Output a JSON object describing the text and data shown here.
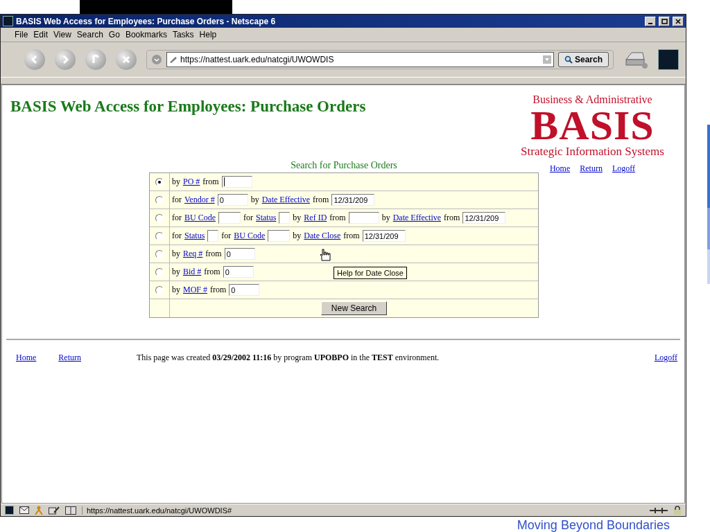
{
  "window": {
    "title": "BASIS Web Access for Employees: Purchase Orders - Netscape 6"
  },
  "menu": [
    "File",
    "Edit",
    "View",
    "Search",
    "Go",
    "Bookmarks",
    "Tasks",
    "Help"
  ],
  "toolbar": {
    "url": "https://nattest.uark.edu/natcgi/UWOWDIS",
    "search_label": "Search"
  },
  "page": {
    "heading": "BASIS Web Access for Employees: Purchase Orders",
    "logo": {
      "top": "Business & Administrative",
      "word": "BASIS",
      "bottom": "Strategic Information Systems"
    },
    "nav_links": [
      "Home",
      "Return",
      "Logoff"
    ],
    "form": {
      "title": "Search for Purchase Orders",
      "rows": [
        {
          "selected": true,
          "parts": [
            {
              "kind": "text",
              "text": "by"
            },
            {
              "kind": "link",
              "text": "PO #"
            },
            {
              "kind": "text",
              "text": "from"
            },
            {
              "kind": "field",
              "focused": true
            }
          ]
        },
        {
          "selected": false,
          "parts": [
            {
              "kind": "text",
              "text": "for"
            },
            {
              "kind": "link",
              "text": "Vendor #"
            },
            {
              "kind": "field",
              "value": "0"
            },
            {
              "kind": "text",
              "text": "by"
            },
            {
              "kind": "link",
              "text": "Date Effective"
            },
            {
              "kind": "text",
              "text": "from"
            },
            {
              "kind": "date",
              "value": "12/31/209"
            }
          ]
        },
        {
          "selected": false,
          "parts": [
            {
              "kind": "text",
              "text": "for"
            },
            {
              "kind": "link",
              "text": "BU Code"
            },
            {
              "kind": "small"
            },
            {
              "kind": "text",
              "text": "for"
            },
            {
              "kind": "link",
              "text": "Status"
            },
            {
              "kind": "tiny"
            },
            {
              "kind": "text",
              "text": "by"
            },
            {
              "kind": "link",
              "text": "Ref ID"
            },
            {
              "kind": "text",
              "text": "from"
            },
            {
              "kind": "field"
            },
            {
              "kind": "text",
              "text": "by"
            },
            {
              "kind": "link",
              "text": "Date Effective"
            },
            {
              "kind": "text",
              "text": "from"
            },
            {
              "kind": "date",
              "value": "12/31/209"
            }
          ]
        },
        {
          "selected": false,
          "parts": [
            {
              "kind": "text",
              "text": "for"
            },
            {
              "kind": "link",
              "text": "Status"
            },
            {
              "kind": "tiny"
            },
            {
              "kind": "text",
              "text": "for"
            },
            {
              "kind": "link",
              "text": "BU Code"
            },
            {
              "kind": "small"
            },
            {
              "kind": "text",
              "text": "by"
            },
            {
              "kind": "link",
              "text": "Date Close"
            },
            {
              "kind": "text",
              "text": "from"
            },
            {
              "kind": "date",
              "value": "12/31/209"
            }
          ]
        },
        {
          "selected": false,
          "parts": [
            {
              "kind": "text",
              "text": "by"
            },
            {
              "kind": "link",
              "text": "Req #"
            },
            {
              "kind": "text",
              "text": "from"
            },
            {
              "kind": "field",
              "value": "0"
            }
          ]
        },
        {
          "selected": false,
          "parts": [
            {
              "kind": "text",
              "text": "by"
            },
            {
              "kind": "link",
              "text": "Bid #"
            },
            {
              "kind": "text",
              "text": "from"
            },
            {
              "kind": "field",
              "value": "0"
            }
          ]
        },
        {
          "selected": false,
          "parts": [
            {
              "kind": "text",
              "text": "by"
            },
            {
              "kind": "link",
              "text": "MOF #"
            },
            {
              "kind": "text",
              "text": "from"
            },
            {
              "kind": "field",
              "value": "0"
            }
          ]
        }
      ],
      "button": "New Search"
    },
    "tooltip": "Help for Date Close",
    "footer": {
      "links_left": [
        "Home",
        "Return"
      ],
      "note": "This page was created **03/29/2002 11:16** by program **UPOBPO** in the **TEST** environment.",
      "link_right": "Logoff"
    }
  },
  "status_bar": {
    "url": "https://nattest.uark.edu/natcgi/UWOWDIS#"
  },
  "slide": {
    "footer": "Moving Beyond Boundaries"
  }
}
